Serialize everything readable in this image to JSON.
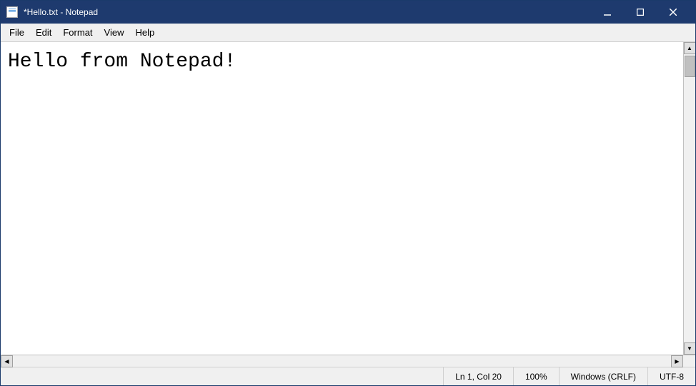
{
  "titleBar": {
    "icon": "notepad-icon",
    "title": "*Hello.txt - Notepad",
    "minimizeLabel": "─",
    "maximizeLabel": "□",
    "closeLabel": "✕"
  },
  "menuBar": {
    "items": [
      {
        "id": "file",
        "label": "File"
      },
      {
        "id": "edit",
        "label": "Edit"
      },
      {
        "id": "format",
        "label": "Format"
      },
      {
        "id": "view",
        "label": "View"
      },
      {
        "id": "help",
        "label": "Help"
      }
    ]
  },
  "editor": {
    "content": "Hello from Notepad!"
  },
  "statusBar": {
    "position": "Ln 1, Col 20",
    "zoom": "100%",
    "lineEnding": "Windows (CRLF)",
    "encoding": "UTF-8"
  }
}
